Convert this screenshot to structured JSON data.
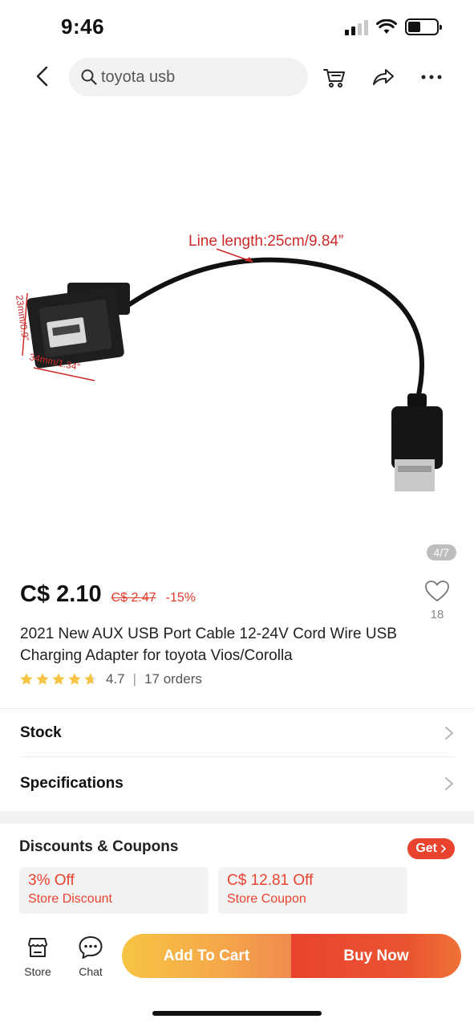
{
  "status_bar": {
    "time": "9:46"
  },
  "header": {
    "search_text": "toyota usb"
  },
  "product_image": {
    "counter": "4/7",
    "annotation_length": "Line length:25cm/9.84”",
    "annotation_height": "23mm/0.9”",
    "annotation_width": "34mm/1.34”"
  },
  "price": {
    "current": "C$ 2.10",
    "original": "C$ 2.47",
    "discount": "-15%"
  },
  "wishlist": {
    "count": "18"
  },
  "product": {
    "title": "2021 New AUX USB Port Cable 12-24V Cord Wire USB Charging Adapter for toyota Vios/Corolla",
    "rating": "4.7",
    "orders": "17 orders"
  },
  "rows": {
    "stock": "Stock",
    "specifications": "Specifications"
  },
  "coupons": {
    "title": "Discounts & Coupons",
    "get_label": "Get",
    "items": [
      {
        "amount": "3% Off",
        "label": "Store Discount"
      },
      {
        "amount": "C$ 12.81 Off",
        "label": "Store Coupon"
      }
    ]
  },
  "bottom_bar": {
    "store_label": "Store",
    "chat_label": "Chat",
    "add_to_cart": "Add To Cart",
    "buy_now": "Buy Now"
  },
  "colors": {
    "accent": "#e8432e",
    "cart_gradient_start": "#f6c443",
    "star": "#f6c443"
  }
}
